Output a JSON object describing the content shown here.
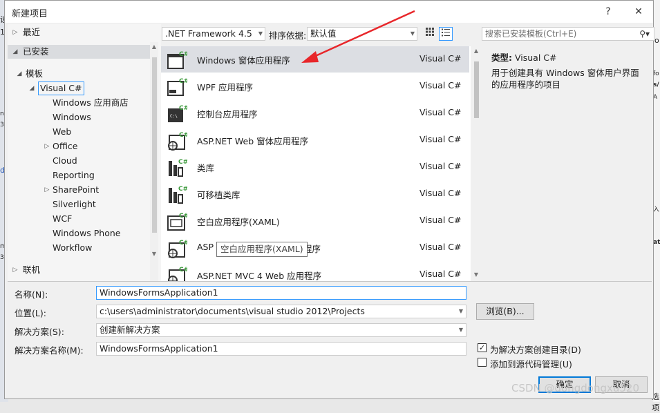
{
  "dialog": {
    "title": "新建项目",
    "help": "?",
    "close": "✕"
  },
  "background": {
    "left_fragments": [
      "设",
      "1",
      "na",
      "3c",
      "d",
      "ma",
      "3c"
    ],
    "right_fragments": [
      "o",
      "fo",
      "s/",
      "A",
      "入",
      "at",
      "选项"
    ]
  },
  "tree": {
    "items": [
      {
        "label": "最近",
        "arrow": "▷",
        "indent": 0
      },
      {
        "label": "已安装",
        "arrow": "◢",
        "indent": 0,
        "selected": true
      },
      {
        "label": "模板",
        "arrow": "◢",
        "indent": 1
      },
      {
        "label": "Visual C#",
        "arrow": "◢",
        "indent": 2,
        "boxed": true
      },
      {
        "label": "Windows 应用商店",
        "arrow": "",
        "indent": 3
      },
      {
        "label": "Windows",
        "arrow": "",
        "indent": 3
      },
      {
        "label": "Web",
        "arrow": "",
        "indent": 3
      },
      {
        "label": "Office",
        "arrow": "▷",
        "indent": 3
      },
      {
        "label": "Cloud",
        "arrow": "",
        "indent": 3
      },
      {
        "label": "Reporting",
        "arrow": "",
        "indent": 3
      },
      {
        "label": "SharePoint",
        "arrow": "▷",
        "indent": 3
      },
      {
        "label": "Silverlight",
        "arrow": "",
        "indent": 3
      },
      {
        "label": "WCF",
        "arrow": "",
        "indent": 3
      },
      {
        "label": "Windows Phone",
        "arrow": "",
        "indent": 3
      },
      {
        "label": "Workflow",
        "arrow": "",
        "indent": 3
      },
      {
        "label": "联机",
        "arrow": "▷",
        "indent": 0
      }
    ]
  },
  "toolbar": {
    "framework": ".NET Framework 4.5",
    "sort_label": "排序依据:",
    "sort_value": "默认值"
  },
  "templates": [
    {
      "name": "Windows 窗体应用程序",
      "lang": "Visual C#",
      "icon": "winforms-icon",
      "selected": true
    },
    {
      "name": "WPF 应用程序",
      "lang": "Visual C#",
      "icon": "wpf-icon"
    },
    {
      "name": "控制台应用程序",
      "lang": "Visual C#",
      "icon": "console-icon"
    },
    {
      "name": "ASP.NET Web 窗体应用程序",
      "lang": "Visual C#",
      "icon": "web-forms-icon"
    },
    {
      "name": "类库",
      "lang": "Visual C#",
      "icon": "class-library-icon"
    },
    {
      "name": "可移植类库",
      "lang": "Visual C#",
      "icon": "portable-library-icon"
    },
    {
      "name": "空白应用程序(XAML)",
      "lang": "Visual C#",
      "icon": "blank-app-icon"
    },
    {
      "name": "ASP",
      "name_tail": "程序",
      "lang": "Visual C#",
      "icon": "asp-mvc3-icon"
    },
    {
      "name": "ASP.NET MVC 4 Web 应用程序",
      "lang": "Visual C#",
      "icon": "asp-mvc4-icon"
    }
  ],
  "tooltip": "空白应用程序(XAML)",
  "search": {
    "placeholder": "搜索已安装模板(Ctrl+E)"
  },
  "details": {
    "type_label": "类型:",
    "type_value": "Visual C#",
    "description": "用于创建具有 Windows 窗体用户界面的应用程序的项目"
  },
  "form": {
    "name_label": "名称(N):",
    "name_value": "WindowsFormsApplication1",
    "location_label": "位置(L):",
    "location_value": "c:\\users\\administrator\\documents\\visual studio 2012\\Projects",
    "browse": "浏览(B)...",
    "solution_label": "解决方案(S):",
    "solution_value": "创建新解决方案",
    "solution_name_label": "解决方案名称(M):",
    "solution_name_value": "WindowsFormsApplication1",
    "create_dir_label": "为解决方案创建目录(D)",
    "create_dir_checked": true,
    "source_control_label": "添加到源代码管理(U)",
    "source_control_checked": false,
    "ok": "确定",
    "cancel": "取消"
  },
  "watermark": "CSDN @dongdongxu520",
  "colors": {
    "accent": "#0078d7",
    "csharp_green": "#3c9a3c",
    "annotation_arrow": "#e8262a"
  }
}
